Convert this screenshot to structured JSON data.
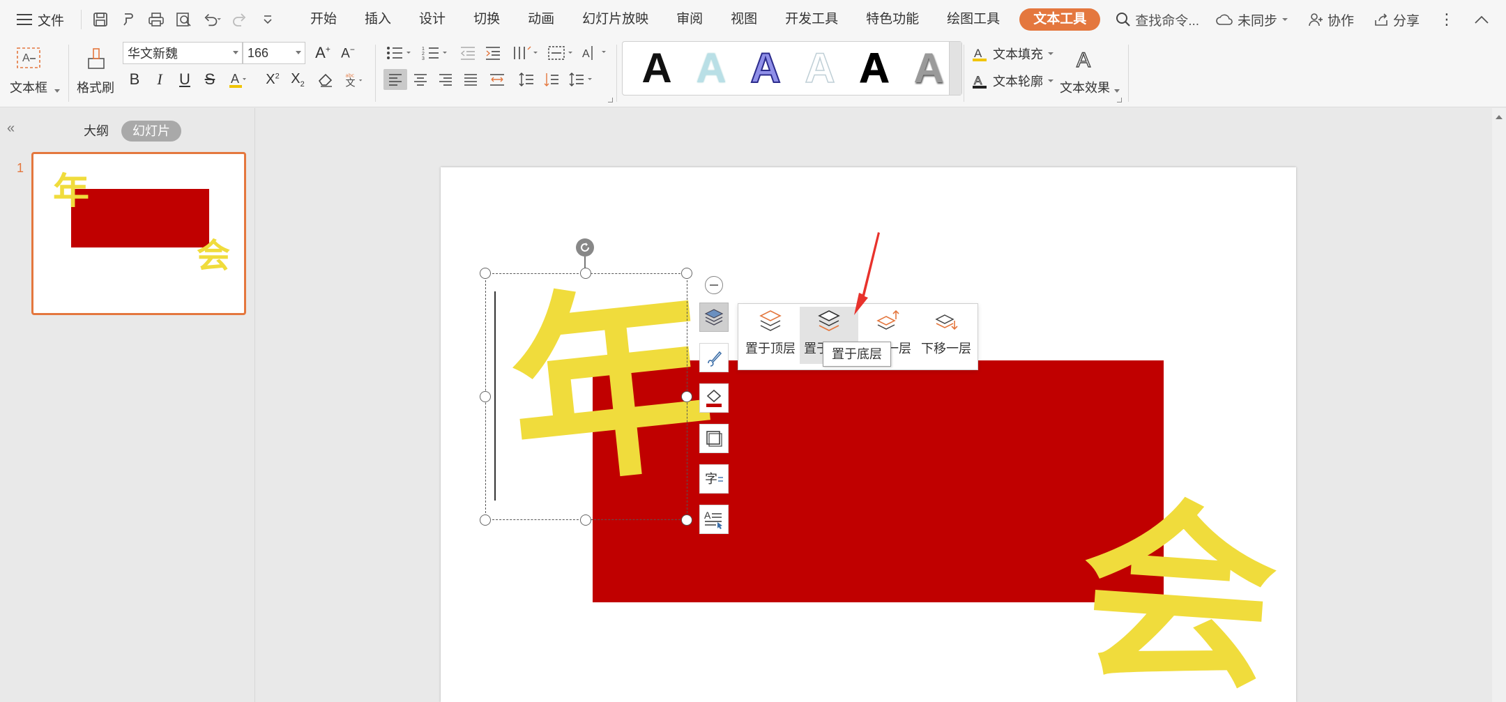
{
  "menubar": {
    "file_label": "文件",
    "tabs": [
      "开始",
      "插入",
      "设计",
      "切换",
      "动画",
      "幻灯片放映",
      "审阅",
      "视图",
      "开发工具",
      "特色功能",
      "绘图工具",
      "文本工具"
    ],
    "active_tab": "文本工具",
    "search_placeholder": "查找命令...",
    "sync_label": "未同步",
    "collab_label": "协作",
    "share_label": "分享"
  },
  "ribbon": {
    "textbox_label": "文本框",
    "format_painter_label": "格式刷",
    "font_name": "华文新魏",
    "font_size": "166",
    "text_fill_label": "文本填充",
    "text_outline_label": "文本轮廓",
    "text_effect_label": "文本效果",
    "style_glyph": "A"
  },
  "left_panel": {
    "tab_outline": "大纲",
    "tab_slides": "幻灯片",
    "slide_number": "1"
  },
  "slide": {
    "char_left": "年",
    "char_right": "会",
    "colors": {
      "rect": "#c00000",
      "text": "#f0dc3c",
      "accent": "#e4773e"
    }
  },
  "arrange_popup": {
    "bring_to_front": "置于顶层",
    "send_to_back_partial": "置于",
    "bring_forward_partial": "一层",
    "send_backward": "下移一层",
    "tooltip": "置于底层"
  }
}
